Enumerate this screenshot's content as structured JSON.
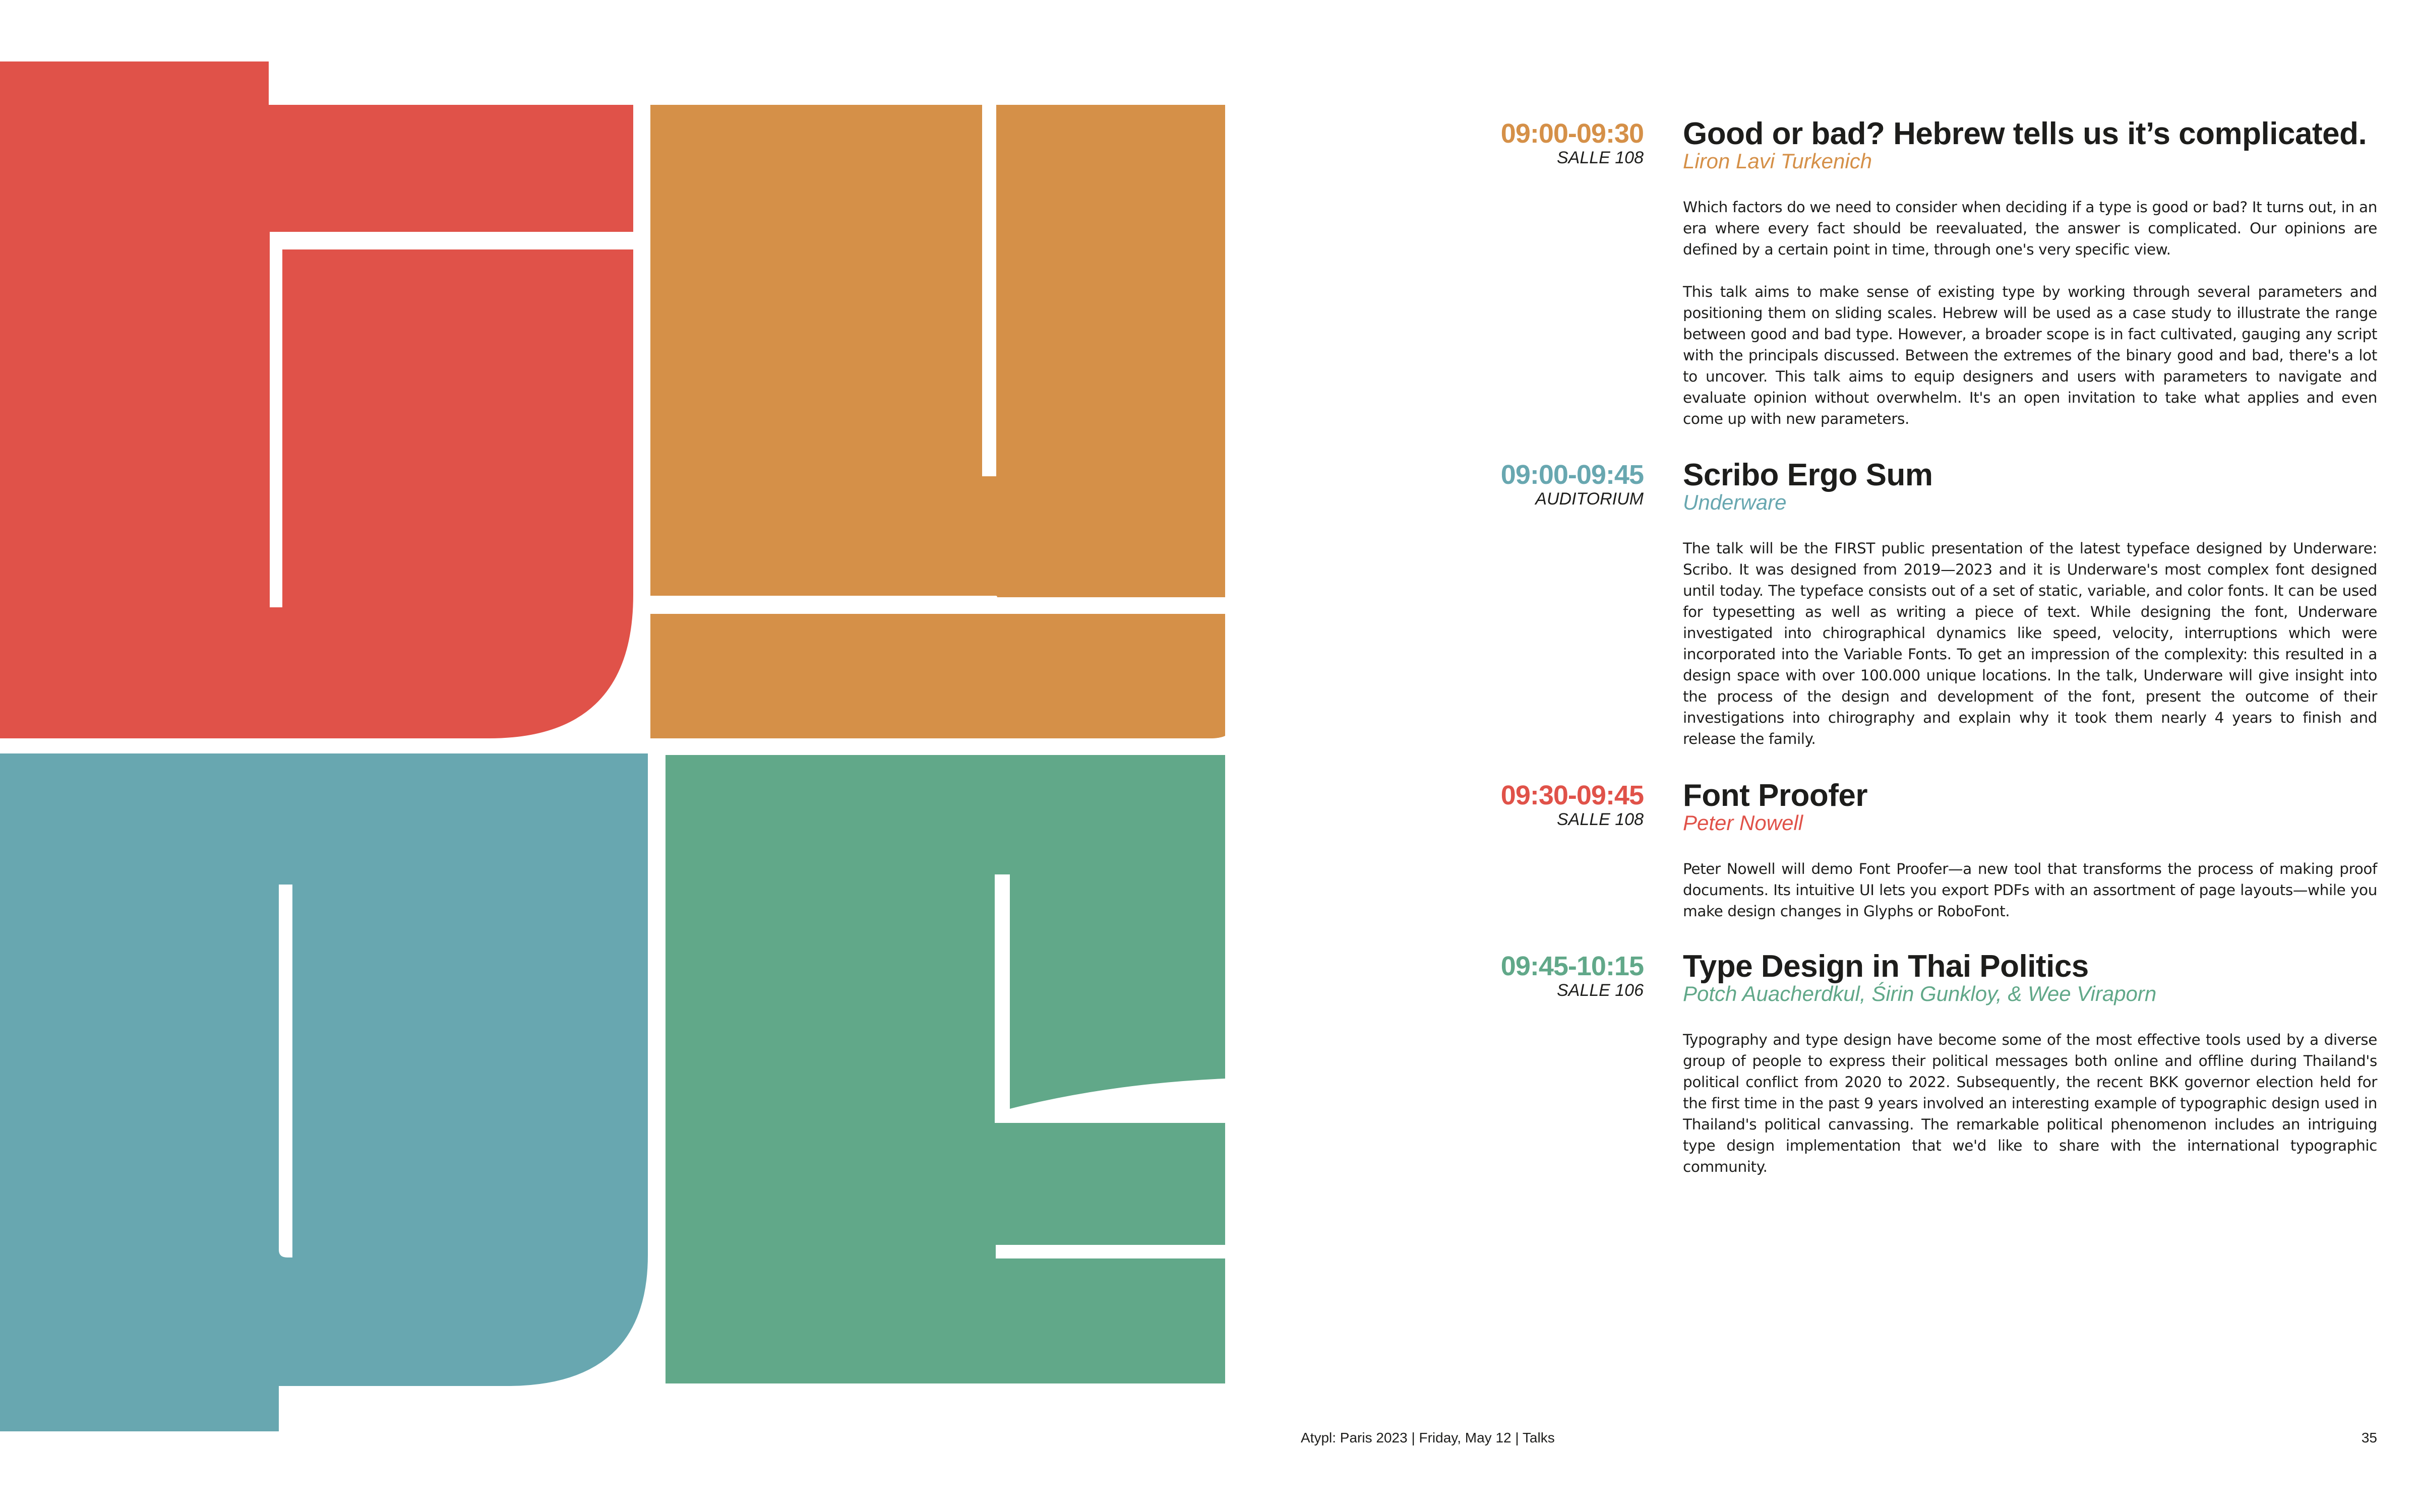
{
  "colors": {
    "red": "#e05249",
    "orange": "#d59048",
    "teal": "#68a7b0",
    "green": "#61a889",
    "text": "#1d1d1b"
  },
  "talks": [
    {
      "time": "09:00-09:30",
      "room": "SALLE 108",
      "title": "Good or bad? Hebrew tells us it’s complicated.",
      "speaker": "Liron Lavi Turkenich",
      "accent": "#d59048",
      "paragraphs": [
        "Which factors do we need to consider when deciding if a type is good or bad? It turns out, in an era where every fact should be reevaluated, the answer is complicated. Our opinions are defined by a certain point in time, through one's very specific view.",
        "This talk aims to make sense of existing type by working through several parameters and positioning them on sliding scales. Hebrew will be used as a case study to illustrate the range between good and bad type. However, a broader scope is in fact cultivated, gauging any script with the principals discussed. Between the extremes of the binary good and bad, there's a lot to uncover. This talk aims to equip designers and users with parameters to navigate and evaluate opinion without overwhelm. It's an open invitation to take what applies and even come up with new parameters."
      ]
    },
    {
      "time": "09:00-09:45",
      "room": "AUDITORIUM",
      "title": "Scribo Ergo Sum",
      "speaker": "Underware",
      "accent": "#68a7b0",
      "paragraphs": [
        "The talk will be the FIRST public presentation of the latest typeface designed by Underware: Scribo. It was designed from 2019—2023 and it is Underware's most complex font designed until today. The typeface consists out of a set of static, variable, and color fonts. It can be used for typesetting as well as writing a piece of text. While designing the font, Underware investigated into chirographical dynamics like speed, velocity, interruptions which were incorporated into the Variable Fonts. To get an impression of the complexity: this resulted in a design space with over 100.000 unique locations. In the talk, Underware will give insight into the process of the design and development of the font, present the outcome of their investigations into chirography and explain why it took them nearly 4 years to finish and release the family."
      ]
    },
    {
      "time": "09:30-09:45",
      "room": "SALLE 108",
      "title": "Font Proofer",
      "speaker": "Peter Nowell",
      "accent": "#e05249",
      "paragraphs": [
        "Peter Nowell will demo Font Proofer—a new tool that transforms the process of making proof documents. Its intuitive UI lets you export PDFs with an assortment of page layouts—while you make design changes in Glyphs or RoboFont."
      ]
    },
    {
      "time": "09:45-10:15",
      "room": "SALLE 106",
      "title": "Type Design in Thai Politics",
      "speaker": "Potch Auacherdkul, Śirin Gunkloy, & Wee Viraporn",
      "accent": "#61a889",
      "paragraphs": [
        "Typography and type design have become some of the most effective tools used by a diverse group of people to express their political messages both online and offline during Thailand's political conflict from 2020 to 2022. Subsequently, the recent BKK governor election held for the first time in the past 9 years involved an interesting example of typographic design used in Thailand's political canvassing. The remarkable political phenomenon includes an intriguing type design implementation that we'd like to share with the international typographic community."
      ]
    }
  ],
  "footer": {
    "left": "Atypl: Paris 2023 | Friday, May 12 | Talks",
    "page": "35"
  }
}
